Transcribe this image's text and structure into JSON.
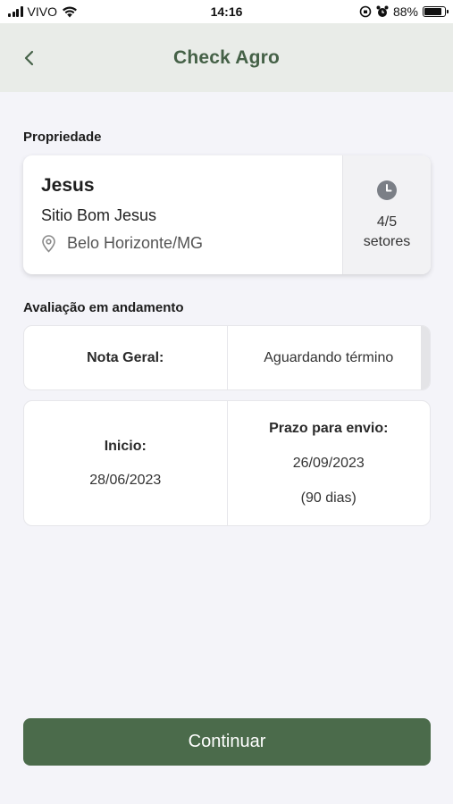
{
  "status_bar": {
    "carrier": "VIVO",
    "time": "14:16",
    "battery": "88%",
    "battery_level": 0.88
  },
  "header": {
    "title": "Check Agro"
  },
  "property_section": {
    "label": "Propriedade",
    "owner": "Jesus",
    "name": "Sitio Bom Jesus",
    "location": "Belo Horizonte/MG",
    "sectors_count": "4/5",
    "sectors_label": "setores"
  },
  "evaluation_section": {
    "label": "Avaliação em andamento",
    "score_label": "Nota Geral:",
    "score_value": "Aguardando término",
    "start_label": "Inicio:",
    "start_date": "28/06/2023",
    "deadline_label": "Prazo para envio:",
    "deadline_date": "26/09/2023",
    "deadline_days": "(90 dias)"
  },
  "actions": {
    "continue_label": "Continuar"
  },
  "colors": {
    "brand": "#4b6b4b",
    "title": "#456147",
    "header_bg": "#e9ece8"
  }
}
